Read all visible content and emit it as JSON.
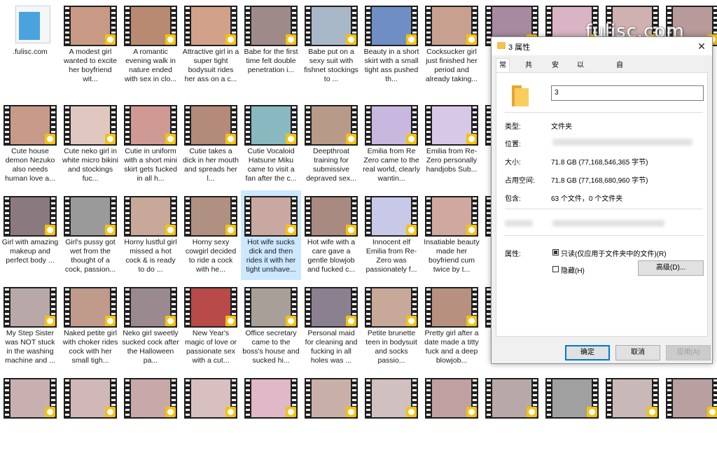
{
  "watermark": "fulisc.com",
  "items": [
    {
      "caption": ".fulisc.com",
      "kind": "doc"
    },
    {
      "caption": "A modest girl wanted to excite her boyfriend wit...",
      "color": "#c89a86"
    },
    {
      "caption": "A romantic evening walk in nature ended with sex in clo...",
      "color": "#b88a72"
    },
    {
      "caption": "Attractive girl in a super tight bodysuit rides her ass on a c...",
      "color": "#d2a18a"
    },
    {
      "caption": "Babe for the first time felt double penetration i...",
      "color": "#9f8a8a"
    },
    {
      "caption": "Babe put on a sexy suit with fishnet stockings to ...",
      "color": "#a9b8c9"
    },
    {
      "caption": "Beauty in a short skirt with a small tight ass pushed th...",
      "color": "#6f8fc4"
    },
    {
      "caption": "Cocksucker girl just finished her period and already taking...",
      "color": "#c8a090"
    },
    {
      "caption": "Co",
      "color": "#a88aa0"
    },
    {
      "caption": "",
      "color": "#d8b4c4"
    },
    {
      "caption": "",
      "color": "#d0b0b0"
    },
    {
      "caption": "",
      "color": "#b89a9a"
    },
    {
      "caption": "Cute house demon Nezuko also needs human love a...",
      "color": "#c79a8a"
    },
    {
      "caption": "Cute neko girl in white micro bikini and stockings fuc...",
      "color": "#e0c8c0"
    },
    {
      "caption": "Cutie in uniform with a short mini skirt gets fucked in all h...",
      "color": "#d09a94"
    },
    {
      "caption": "Cutie takes a dick in her mouth and spreads her l...",
      "color": "#b48a7a"
    },
    {
      "caption": "Cutie Vocaloid Hatsune Miku came to visit a fan after the c...",
      "color": "#8ab8c0"
    },
    {
      "caption": "Deepthroat training for submissive depraved sex...",
      "color": "#b89a88"
    },
    {
      "caption": "Emilia from Re Zero came to the real world, clearly wantin...",
      "color": "#c8b8e0"
    },
    {
      "caption": "Emilia from Re-Zero personally handjobs Sub...",
      "color": "#d8c8e8"
    },
    {
      "caption": "s vi",
      "color": "#c0a0a0"
    },
    {
      "caption": "Girl with amazing makeup and perfect body ...",
      "color": "#8a7a80"
    },
    {
      "caption": "Girl's pussy got wet from the thought of a cock, passion...",
      "color": "#9a9a9a"
    },
    {
      "caption": "Horny lustful girl missed a hot cock & is ready to do ...",
      "color": "#c8a898"
    },
    {
      "caption": "Horny sexy cowgirl decided to ride a cock with he...",
      "color": "#b09080"
    },
    {
      "caption": "Hot wife sucks dick and then rides it with her tight unshave...",
      "color": "#c8a8a0"
    },
    {
      "caption": "Hot wife with a care gave a gentle blowjob and fucked c...",
      "color": "#a88a80"
    },
    {
      "caption": "Innocent elf Emilia from Re-Zero was passionately f...",
      "color": "#c8c8e8"
    },
    {
      "caption": "Insatiable beauty made her boyfriend cum twice by t...",
      "color": "#d0a8a0"
    },
    {
      "caption": "I to",
      "color": "#b89a9a"
    },
    {
      "caption": "My Step Sister was NOT stuck in the washing machine and ...",
      "color": "#b8a8a8"
    },
    {
      "caption": "Naked petite girl with choker rides cock with her small tigh...",
      "color": "#c09a8a"
    },
    {
      "caption": "Neko girl sweetly sucked cock after the Halloween pa...",
      "color": "#9a8a90"
    },
    {
      "caption": "New Year's magic of love or passionate sex with a cut...",
      "color": "#b84a4a"
    },
    {
      "caption": "Office secretary came to the boss's house and sucked hi...",
      "color": "#a8a098"
    },
    {
      "caption": "Personal maid for cleaning and fucking in all holes was ...",
      "color": "#8a8090"
    },
    {
      "caption": "Petite brunette teen in bodysuit and socks passio...",
      "color": "#c8a898"
    },
    {
      "caption": "Pretty girl after a date made a titty fuck and a deep blowjob...",
      "color": "#b89080"
    },
    {
      "caption": "F s h",
      "color": "#b0a0a0"
    },
    {
      "caption": "",
      "color": "#c8b0b0"
    },
    {
      "caption": "",
      "color": "#d0b8b8"
    },
    {
      "caption": "",
      "color": "#c8a8a8"
    },
    {
      "caption": "",
      "color": "#d8c0c0"
    },
    {
      "caption": "",
      "color": "#e0b8c8"
    },
    {
      "caption": "",
      "color": "#c8b0a8"
    },
    {
      "caption": "",
      "color": "#d0c0c0"
    },
    {
      "caption": "",
      "color": "#c0a0a0"
    },
    {
      "caption": "",
      "color": "#b8a8a8"
    },
    {
      "caption": "",
      "color": "#a0a0a0"
    },
    {
      "caption": "",
      "color": "#c8b8b8"
    },
    {
      "caption": "",
      "color": "#b8a0a0"
    }
  ],
  "selected_index": 25,
  "badge_text": "Player",
  "dialog": {
    "title": "3 属性",
    "close": "✕",
    "tabs": [
      "常规",
      "共享",
      "安全",
      "以前的版本",
      "自定义"
    ],
    "active_tab": "常规",
    "name": "3",
    "type_label": "类型:",
    "type_value": "文件夹",
    "location_label": "位置:",
    "size_label": "大小:",
    "size_value": "71.8 GB (77,168,546,365 字节)",
    "disk_label": "占用空间:",
    "disk_value": "71.8 GB (77,168,680,960 字节)",
    "contains_label": "包含:",
    "contains_value": "63 个文件，0 个文件夹",
    "attr_label": "属性:",
    "readonly_label": "只读(仅应用于文件夹中的文件)(R)",
    "readonly_checked": true,
    "hidden_label": "隐藏(H)",
    "hidden_checked": false,
    "advanced_label": "高级(D)...",
    "ok_label": "确定",
    "cancel_label": "取消",
    "apply_label": "应用(A)"
  }
}
